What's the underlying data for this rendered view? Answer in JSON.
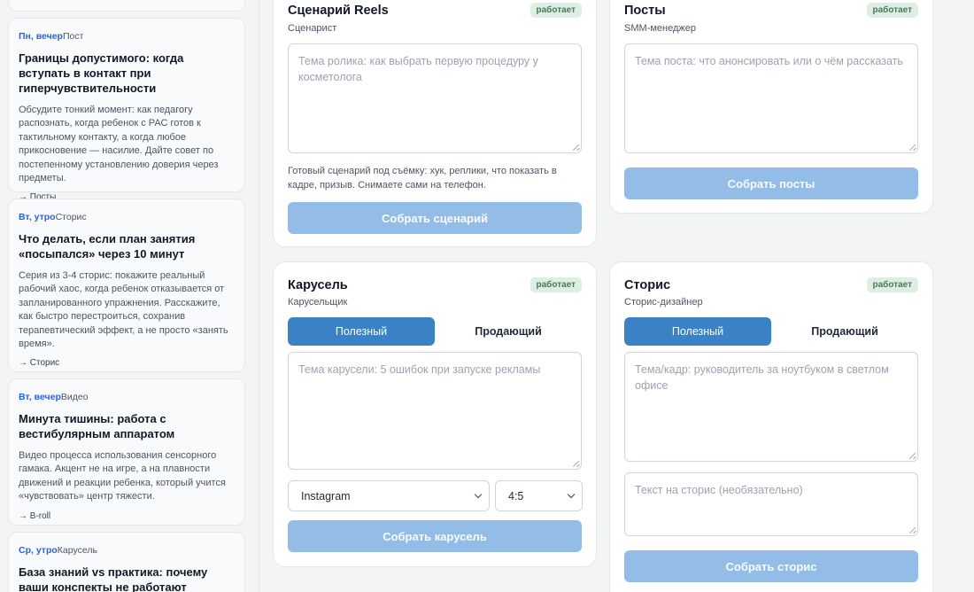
{
  "plan": [
    {
      "when": "Пн, вечер",
      "type": "Пост",
      "title": "Границы допустимого: когда вступать в контакт при гиперчувствительности",
      "desc": "Обсудите тонкий момент: как педагогу распознать, когда ребенок с РАС готов к тактильному контакту, а когда любое прикосновение — насилие. Дайте совет по постепенному установлению доверия через предметы.",
      "target": "→ Посты"
    },
    {
      "when": "Вт, утро",
      "type": "Сторис",
      "title": "Что делать, если план занятия «посыпался» через 10 минут",
      "desc": "Серия из 3-4 сторис: покажите реальный рабочий хаос, когда ребенок отказывается от запланированного упражнения. Расскажите, как быстро перестроиться, сохранив терапевтический эффект, а не просто «занять время».",
      "target": "→ Сторис"
    },
    {
      "when": "Вт, вечер",
      "type": "Видео",
      "title": "Минута тишины: работа с вестибулярным аппаратом",
      "desc": "Видео процесса использования сенсорного гамака. Акцент не на игре, а на плавности движений и реакции ребенка, который учится «чувствовать» центр тяжести.",
      "target": "→ B-roll"
    },
    {
      "when": "Ср, утро",
      "type": "Карусель",
      "title": "База знаний vs практика: почему ваши конспекты не работают",
      "desc": "",
      "target": ""
    }
  ],
  "reels": {
    "title": "Сценарий Reels",
    "role": "Сценарист",
    "badge": "работает",
    "placeholder": "Тема ролика: как выбрать первую процедуру у косметолога",
    "helper": "Готовый сценарий под съёмку: хук, реплики, что показать в кадре, призыв. Снимаете сами на телефон.",
    "button": "Собрать сценарий"
  },
  "posts": {
    "title": "Посты",
    "role": "SMM-менеджер",
    "badge": "работает",
    "placeholder": "Тема поста: что анонсировать или о чём рассказать",
    "button": "Собрать посты"
  },
  "carousel": {
    "title": "Карусель",
    "role": "Карусельщик",
    "badge": "работает",
    "tab_useful": "Полезный",
    "tab_selling": "Продающий",
    "placeholder": "Тема карусели: 5 ошибок при запуске рекламы",
    "platform": "Instagram",
    "ratio": "4:5",
    "button": "Собрать карусель"
  },
  "stories": {
    "title": "Сторис",
    "role": "Сторис-дизайнер",
    "badge": "работает",
    "tab_useful": "Полезный",
    "tab_selling": "Продающий",
    "placeholder_topic": "Тема/кадр: руководитель за ноутбуком в светлом офисе",
    "placeholder_text": "Текст на сторис (необязательно)",
    "button": "Собрать сторис"
  },
  "colors": {
    "accent": "#3b82c4",
    "button_disabled": "#93bde6",
    "badge_bg": "#dcefe2",
    "badge_text": "#4b7a5c",
    "day_label": "#2563eb"
  }
}
